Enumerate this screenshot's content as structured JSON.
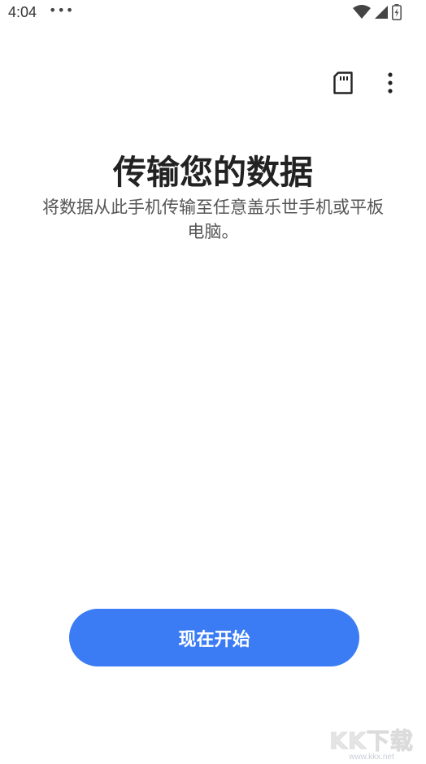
{
  "status_bar": {
    "time": "4:04",
    "dots": "•••",
    "icons": [
      "wifi-icon",
      "cell-signal-icon",
      "battery-charging-icon"
    ]
  },
  "toolbar": {
    "icons": [
      "sd-card-icon",
      "more-vert-icon"
    ]
  },
  "main": {
    "title": "传输您的数据",
    "subtitle": "将数据从此手机传输至任意盖乐世手机或平板电脑。"
  },
  "start_button": {
    "label": "现在开始"
  },
  "watermark": {
    "logo": "KK下载",
    "url": "www.kkx.net"
  },
  "colors": {
    "accent": "#3b7cf5",
    "text": "#222222",
    "subtext": "#555555",
    "background": "#ffffff"
  }
}
